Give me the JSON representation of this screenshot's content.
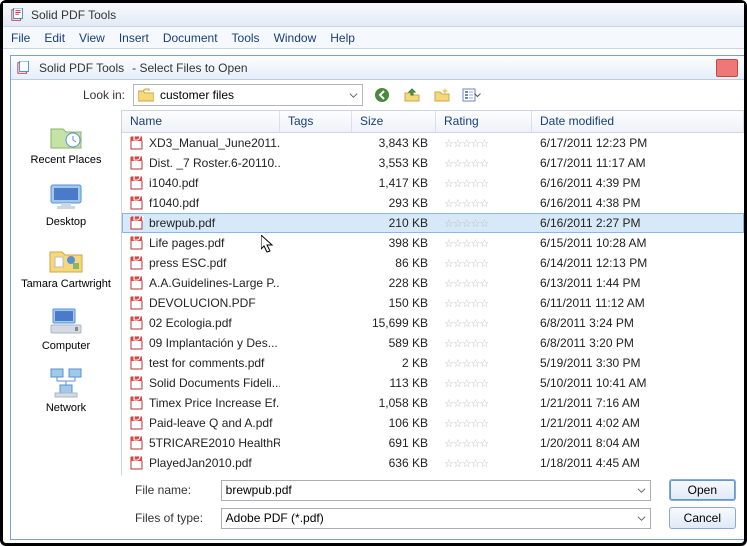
{
  "app": {
    "title": "Solid PDF Tools"
  },
  "menu": [
    "File",
    "Edit",
    "View",
    "Insert",
    "Document",
    "Tools",
    "Window",
    "Help"
  ],
  "dialog": {
    "title": "Solid PDF Tools",
    "subtitle": "- Select Files to Open"
  },
  "lookin": {
    "label": "Look in:",
    "folder": "customer files"
  },
  "places": [
    {
      "key": "recent",
      "label": "Recent Places"
    },
    {
      "key": "desktop",
      "label": "Desktop"
    },
    {
      "key": "user",
      "label": "Tamara Cartwright"
    },
    {
      "key": "computer",
      "label": "Computer"
    },
    {
      "key": "network",
      "label": "Network"
    }
  ],
  "columns": {
    "name": "Name",
    "tags": "Tags",
    "size": "Size",
    "rating": "Rating",
    "date": "Date modified"
  },
  "rating_glyph": "☆☆☆☆☆",
  "files": [
    {
      "name": "XD3_Manual_June2011...",
      "size": "3,843 KB",
      "date": "6/17/2011 12:23 PM",
      "sel": false
    },
    {
      "name": "Dist. _7 Roster.6-20110...",
      "size": "3,553 KB",
      "date": "6/17/2011 11:17 AM",
      "sel": false
    },
    {
      "name": "i1040.pdf",
      "size": "1,417 KB",
      "date": "6/16/2011 4:39 PM",
      "sel": false
    },
    {
      "name": "f1040.pdf",
      "size": "293 KB",
      "date": "6/16/2011 4:38 PM",
      "sel": false
    },
    {
      "name": "brewpub.pdf",
      "size": "210 KB",
      "date": "6/16/2011 2:27 PM",
      "sel": true
    },
    {
      "name": "Life pages.pdf",
      "size": "398 KB",
      "date": "6/15/2011 10:28 AM",
      "sel": false
    },
    {
      "name": "press ESC.pdf",
      "size": "86 KB",
      "date": "6/14/2011 12:13 PM",
      "sel": false
    },
    {
      "name": "A.A.Guidelines-Large P...",
      "size": "228 KB",
      "date": "6/13/2011 1:44 PM",
      "sel": false
    },
    {
      "name": "DEVOLUCION.PDF",
      "size": "150 KB",
      "date": "6/11/2011 11:12 AM",
      "sel": false
    },
    {
      "name": "02 Ecologia.pdf",
      "size": "15,699 KB",
      "date": "6/8/2011 3:24 PM",
      "sel": false
    },
    {
      "name": "09 Implantación y Des...",
      "size": "589 KB",
      "date": "6/8/2011 3:20 PM",
      "sel": false
    },
    {
      "name": "test for comments.pdf",
      "size": "2 KB",
      "date": "5/19/2011 3:30 PM",
      "sel": false
    },
    {
      "name": "Solid Documents Fideli...",
      "size": "113 KB",
      "date": "5/10/2011 10:41 AM",
      "sel": false
    },
    {
      "name": "Timex Price Increase Ef...",
      "size": "1,058 KB",
      "date": "1/21/2011 7:16 AM",
      "sel": false
    },
    {
      "name": "Paid-leave Q and A.pdf",
      "size": "106 KB",
      "date": "1/21/2011 4:02 AM",
      "sel": false
    },
    {
      "name": "5TRICARE2010 HealthR...",
      "size": "691 KB",
      "date": "1/20/2011 8:04 AM",
      "sel": false
    },
    {
      "name": "PlayedJan2010.pdf",
      "size": "636 KB",
      "date": "1/18/2011 4:45 AM",
      "sel": false
    }
  ],
  "filename": {
    "label": "File name:",
    "value": "brewpub.pdf"
  },
  "filetype": {
    "label": "Files of type:",
    "value": "Adobe PDF (*.pdf)"
  },
  "buttons": {
    "open": "Open",
    "cancel": "Cancel"
  }
}
